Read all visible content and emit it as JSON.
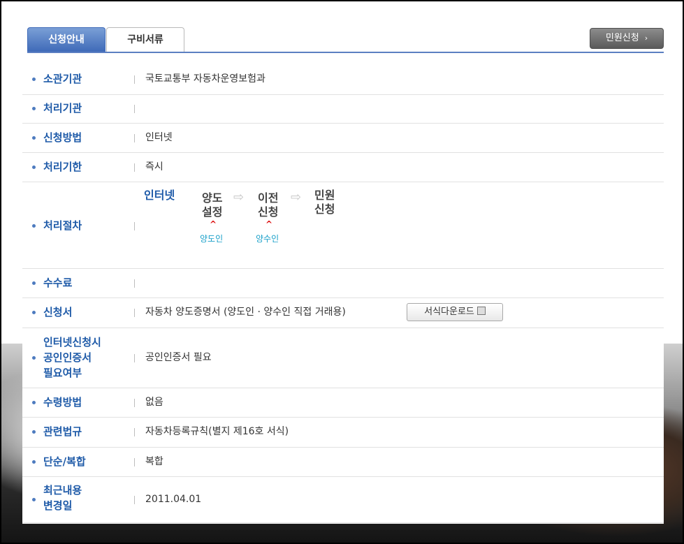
{
  "tabs": [
    {
      "label": "신청안내",
      "active": true
    },
    {
      "label": "구비서류",
      "active": false
    }
  ],
  "apply_button": {
    "label": "민원신청",
    "arrow": "›"
  },
  "rows": [
    {
      "label": "소관기관",
      "value": "국토교통부 자동차운영보험과"
    },
    {
      "label": "처리기관",
      "value": ""
    },
    {
      "label": "신청방법",
      "value": "인터넷"
    },
    {
      "label": "처리기한",
      "value": "즉시"
    },
    {
      "label": "처리절차",
      "value": ""
    },
    {
      "label": "수수료",
      "value": ""
    },
    {
      "label": "신청서",
      "value": "자동차 양도증명서 (양도인 · 양수인 직접 거래용)"
    },
    {
      "label": "인터넷신청시\n공인인증서\n필요여부",
      "value": "공인인증서 필요"
    },
    {
      "label": "수령방법",
      "value": "없음"
    },
    {
      "label": "관련법규",
      "value": "자동차등록규칙(별지 제16호 서식)"
    },
    {
      "label": "단순/복합",
      "value": "복합"
    },
    {
      "label": "최근내용\n변경일",
      "value": "2011.04.01"
    }
  ],
  "procedure": {
    "steps": [
      "인터넷",
      "양도\n설정",
      "이전\n신청",
      "민원\n신청"
    ],
    "arrow": "⇨",
    "caret": "^",
    "sub_labels": [
      "양도인",
      "양수인"
    ]
  },
  "download_button": {
    "label": "서식다운로드"
  },
  "colors": {
    "accent": "#1e5aa8",
    "tab_active": "#4a74c0",
    "sub_label": "#1aa0c9",
    "caret": "#dd1111"
  }
}
